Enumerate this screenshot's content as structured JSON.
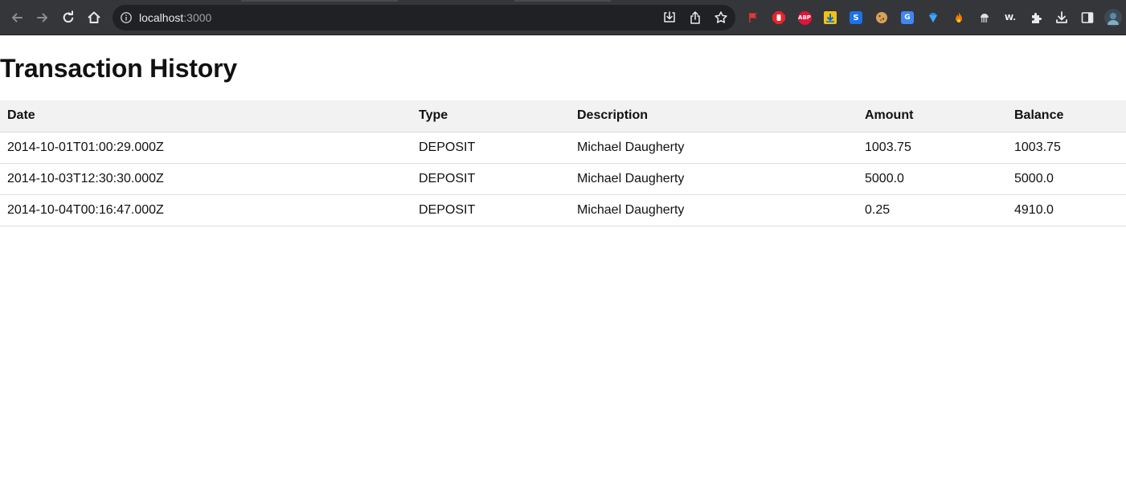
{
  "browser": {
    "url_host": "localhost",
    "url_port": ":3000",
    "icons": {
      "back": "arrow-left-icon",
      "forward": "arrow-right-icon",
      "reload": "reload-icon",
      "home": "home-icon",
      "site_info": "info-icon",
      "install": "install-app-icon",
      "share": "share-icon",
      "bookmark": "star-icon"
    },
    "extensions": [
      {
        "name": "flag-extension-icon",
        "badge": "",
        "color": "#d93025"
      },
      {
        "name": "hand-block-extension-icon",
        "badge": "",
        "color": "#e8232a"
      },
      {
        "name": "abp-extension-icon",
        "badge": "ABP",
        "color": "#e0143c"
      },
      {
        "name": "download-arrow-extension-icon",
        "badge": "",
        "color": "#f4c20d"
      },
      {
        "name": "s-extension-icon",
        "badge": "S",
        "color": "#1a73e8"
      },
      {
        "name": "cookie-extension-icon",
        "badge": "",
        "color": "#c58a3b"
      },
      {
        "name": "google-translate-extension-icon",
        "badge": "G",
        "color": "#4285f4"
      },
      {
        "name": "gem-extension-icon",
        "badge": "",
        "color": "#1e88e5"
      },
      {
        "name": "fire-extension-icon",
        "badge": "",
        "color": "#f57c00"
      },
      {
        "name": "jellyfish-extension-icon",
        "badge": "",
        "color": "#bdbdbd"
      },
      {
        "name": "w-extension-icon",
        "badge": "W.",
        "color": "#35363a"
      },
      {
        "name": "puzzle-extensions-icon",
        "badge": "",
        "color": "#e8eaed"
      },
      {
        "name": "downloads-icon",
        "badge": "",
        "color": "#e8eaed"
      },
      {
        "name": "side-panel-icon",
        "badge": "",
        "color": "#e8eaed"
      },
      {
        "name": "profile-avatar",
        "badge": "",
        "color": "#5b8aa6"
      }
    ]
  },
  "page": {
    "title": "Transaction History",
    "columns": [
      "Date",
      "Type",
      "Description",
      "Amount",
      "Balance"
    ],
    "rows": [
      {
        "date": "2014-10-01T01:00:29.000Z",
        "type": "DEPOSIT",
        "description": "Michael Daugherty",
        "amount": "1003.75",
        "balance": "1003.75"
      },
      {
        "date": "2014-10-03T12:30:30.000Z",
        "type": "DEPOSIT",
        "description": "Michael Daugherty",
        "amount": "5000.0",
        "balance": "5000.0"
      },
      {
        "date": "2014-10-04T00:16:47.000Z",
        "type": "DEPOSIT",
        "description": "Michael Daugherty",
        "amount": "0.25",
        "balance": "4910.0"
      }
    ]
  },
  "colors": {
    "toolbar": "#35363a",
    "omnibox": "#202124",
    "header_row": "#f2f2f2",
    "row_border": "#dcdcdc"
  }
}
